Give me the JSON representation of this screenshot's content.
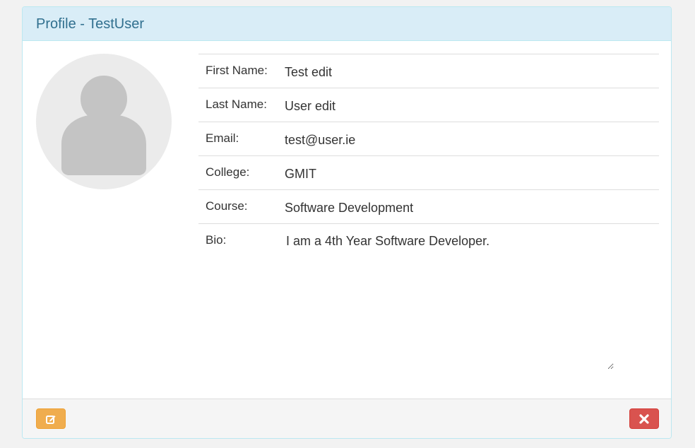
{
  "panel": {
    "title": "Profile - TestUser"
  },
  "avatar": {
    "icon": "user-silhouette-icon"
  },
  "profile": {
    "fields": [
      {
        "label": "First Name:",
        "value": "Test edit"
      },
      {
        "label": "Last Name:",
        "value": "User edit"
      },
      {
        "label": "Email:",
        "value": "test@user.ie"
      },
      {
        "label": "College:",
        "value": "GMIT"
      },
      {
        "label": "Course:",
        "value": "Software Development"
      }
    ],
    "bio": {
      "label": "Bio:",
      "value": "I am a 4th Year Software Developer."
    }
  },
  "footer": {
    "edit_icon": "edit-icon",
    "close_icon": "close-icon"
  },
  "colors": {
    "heading_bg": "#d9edf7",
    "heading_text": "#31708f",
    "edit_button": "#f0ad4e",
    "close_button": "#d9534f"
  }
}
